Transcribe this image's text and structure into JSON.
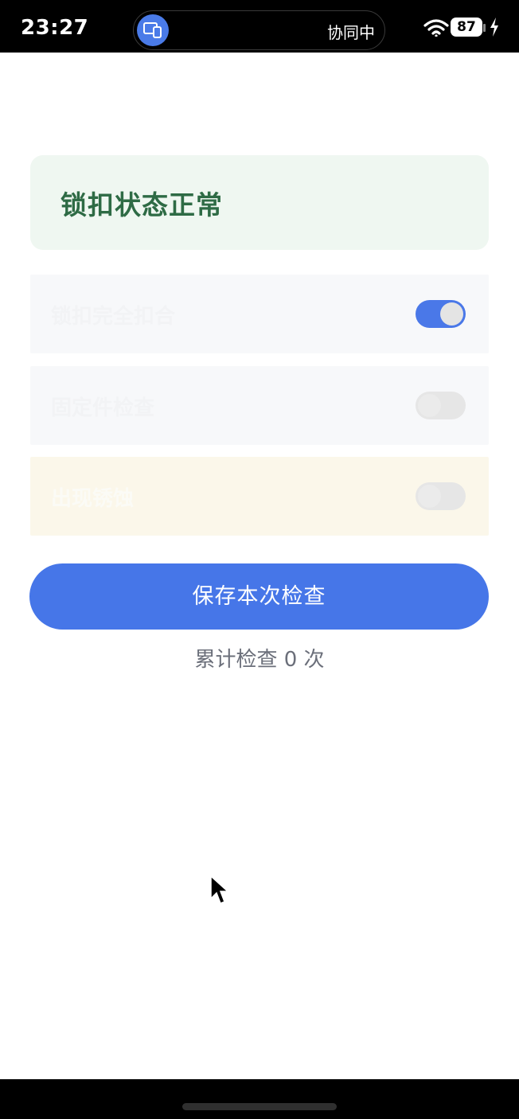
{
  "status_bar": {
    "time": "23:27",
    "island_label": "协同中",
    "battery": "87",
    "icons": [
      "screen-share-icon",
      "wifi-icon",
      "battery-icon",
      "charging-bolt-icon"
    ]
  },
  "status_card": {
    "title": "锁扣状态正常"
  },
  "checks": [
    {
      "label": "锁扣完全扣合",
      "enabled": true
    },
    {
      "label": "固定件检查",
      "enabled": false
    },
    {
      "label": "出现锈蚀",
      "enabled": false
    }
  ],
  "save_button": {
    "label": "保存本次检查"
  },
  "summary": {
    "count_text": "累计检查 0 次",
    "count": 0
  },
  "colors": {
    "accent": "#4676e8",
    "ok_card_bg": "#eff7f1",
    "ok_text": "#2e6b45",
    "warn_row_bg": "#fbf7ea"
  }
}
